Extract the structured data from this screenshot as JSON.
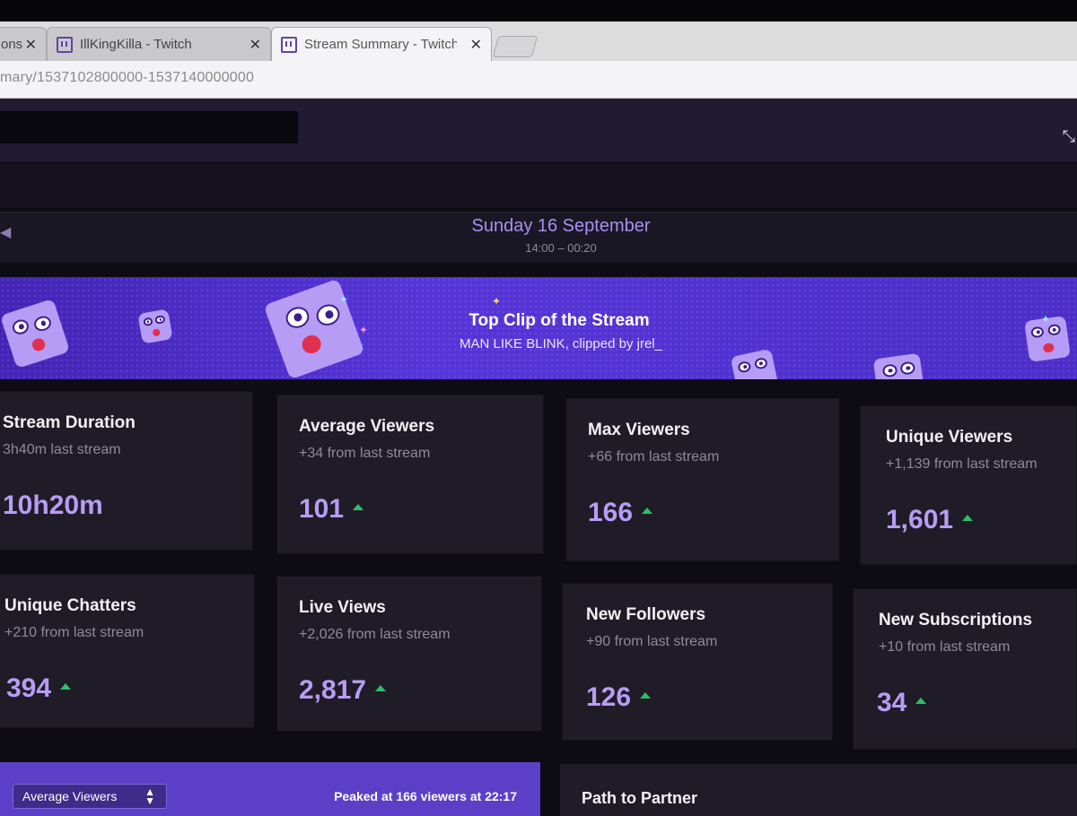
{
  "browser": {
    "tabs": [
      {
        "title": "ons"
      },
      {
        "title": "IllKingKilla - Twitch"
      },
      {
        "title": "Stream Summary - Twitch"
      }
    ],
    "url": "mary/1537102800000-1537140000000"
  },
  "summary": {
    "date": "Sunday 16 September",
    "time_range": "14:00 – 00:20"
  },
  "top_clip": {
    "heading": "Top Clip of the Stream",
    "subtitle": "MAN LIKE BLINK, clipped by jrel_"
  },
  "stats": [
    {
      "label": "Stream Duration",
      "delta": "3h40m last stream",
      "value": "10h20m",
      "trend": "none"
    },
    {
      "label": "Average Viewers",
      "delta": "+34 from last stream",
      "value": "101",
      "trend": "up"
    },
    {
      "label": "Max Viewers",
      "delta": "+66 from last stream",
      "value": "166",
      "trend": "up"
    },
    {
      "label": "Unique Viewers",
      "delta": "+1,139 from last stream",
      "value": "1,601",
      "trend": "up"
    },
    {
      "label": "Unique Chatters",
      "delta": "+210 from last stream",
      "value": "394",
      "trend": "up"
    },
    {
      "label": "Live Views",
      "delta": "+2,026 from last stream",
      "value": "2,817",
      "trend": "up"
    },
    {
      "label": "New Followers",
      "delta": "+90 from last stream",
      "value": "126",
      "trend": "up"
    },
    {
      "label": "New Subscriptions",
      "delta": "+10 from last stream",
      "value": "34",
      "trend": "up"
    }
  ],
  "chart_panel": {
    "metric_select": "Average Viewers",
    "peak_text": "Peaked at 166 viewers at 22:17"
  },
  "partner_panel": {
    "title": "Path to Partner"
  },
  "colors": {
    "accent": "#a98ff2",
    "value_text": "#b89cf4",
    "trend_up": "#2ebd6b",
    "banner": "#4b2ec8",
    "card_bg": "#1f1c27"
  },
  "icons": [
    "twitch-icon",
    "close-icon",
    "chevron-left-icon",
    "trend-up-icon",
    "select-arrows-icon"
  ]
}
